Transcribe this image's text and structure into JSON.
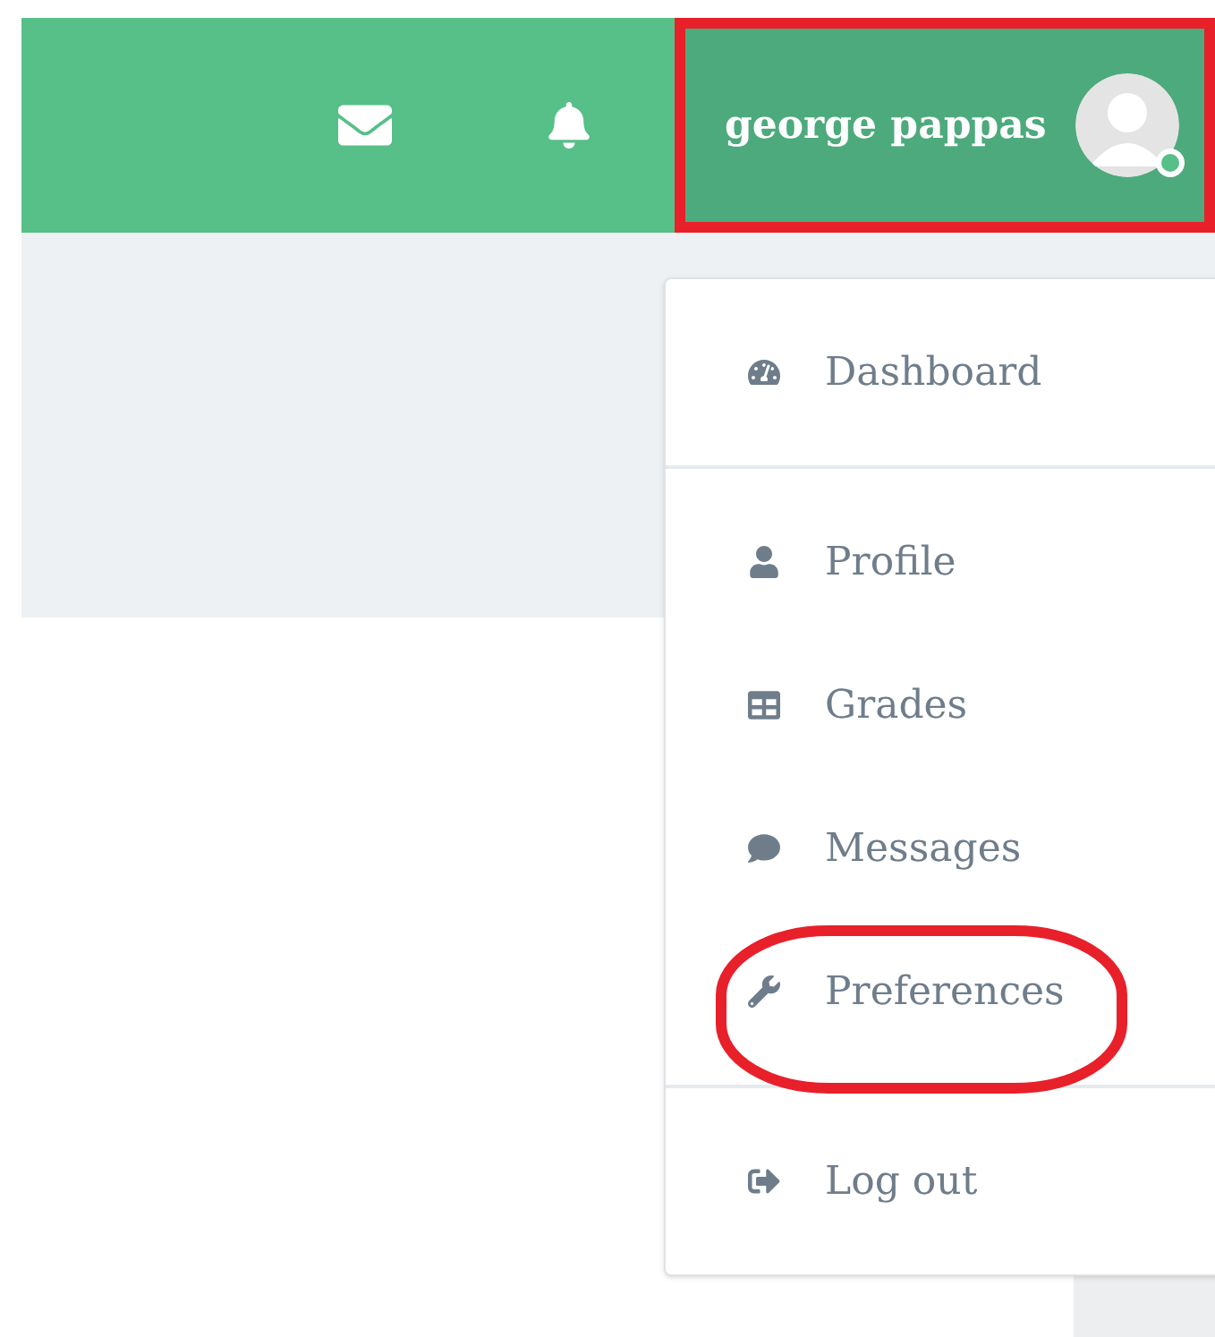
{
  "header": {
    "icons": [
      {
        "kind": "messages"
      },
      {
        "kind": "notifications"
      }
    ],
    "user_menu": {
      "name": "george pappas",
      "online": true,
      "highlighted": true
    }
  },
  "dropdown": {
    "groups": [
      {
        "items": [
          {
            "kind": "dashboard",
            "label": "Dashboard",
            "highlighted": false
          }
        ]
      },
      {
        "items": [
          {
            "kind": "profile",
            "label": "Profile",
            "highlighted": false
          },
          {
            "kind": "grades",
            "label": "Grades",
            "highlighted": false
          },
          {
            "kind": "messages",
            "label": "Messages",
            "highlighted": false
          },
          {
            "kind": "preferences",
            "label": "Preferences",
            "highlighted": true
          }
        ]
      },
      {
        "items": [
          {
            "kind": "logout",
            "label": "Log out",
            "highlighted": false
          }
        ]
      }
    ]
  }
}
